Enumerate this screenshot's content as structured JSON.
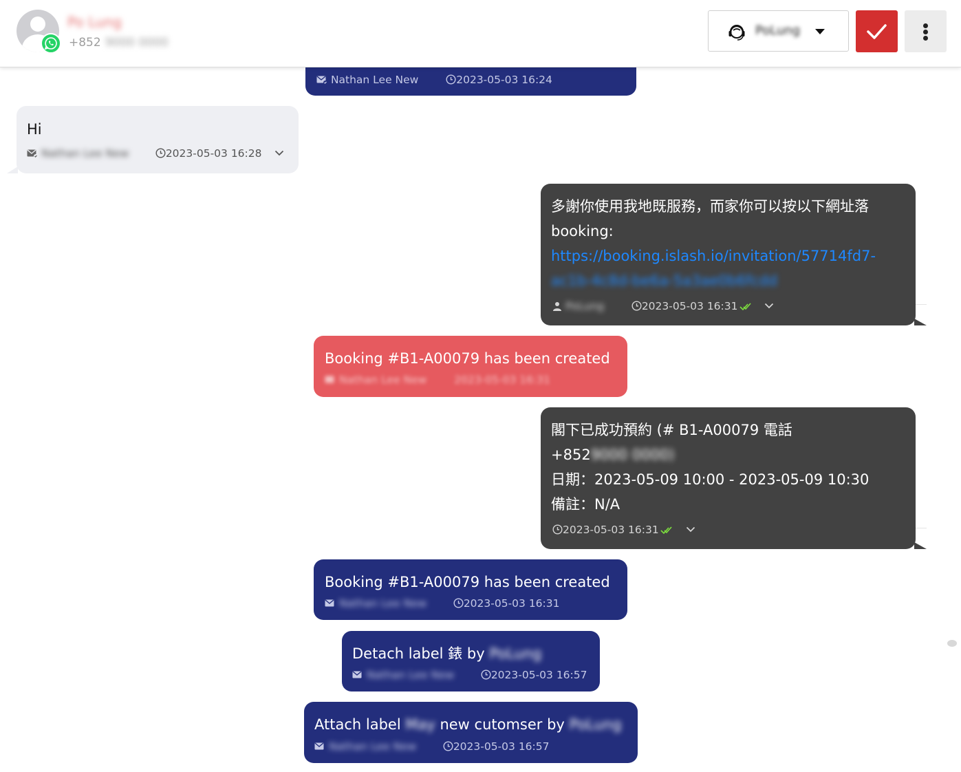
{
  "header": {
    "contact_name": "Po Lung",
    "contact_phone_prefix": "+852",
    "contact_phone_rest": "9000 0000",
    "agent_name": "PoLung",
    "colors": {
      "resolve": "#d32f2f",
      "whatsapp": "#25d366"
    }
  },
  "messages": {
    "m0": {
      "sender": "Nathan Lee New",
      "time": "2023-05-03 16:24"
    },
    "m1": {
      "text": "Hi",
      "sender": "Nathan Lee New",
      "time": "2023-05-03 16:28"
    },
    "m2": {
      "line1": "多謝你使用我地既服務，而家你可以按以下網址落",
      "line2": "booking:",
      "link1": "https://booking.islash.io/invitation/57714fd7-",
      "link2": "ac1b-4c8d-be6a-5a3ae0b6fcdd",
      "sender": "PoLung",
      "time": "2023-05-03 16:31"
    },
    "m3": {
      "text": "Booking #B1-A00079 has been created",
      "sender": "Nathan Lee New",
      "time": "2023-05-03 16:31"
    },
    "m4": {
      "line1": "閣下已成功預約 (# B1-A00079 電話",
      "line2_prefix": "+852",
      "line2_blur": "9000 0000)",
      "line3": "日期：2023-05-09 10:00 - 2023-05-09 10:30",
      "line4": "備註：N/A",
      "time": "2023-05-03 16:31"
    },
    "m5": {
      "text": "Booking #B1-A00079 has been created",
      "sender": "Nathan Lee New",
      "time": "2023-05-03 16:31"
    },
    "m6": {
      "text_prefix": "Detach label 錶 by",
      "text_blur": "PoLung",
      "sender": "Nathan Lee New",
      "time": "2023-05-03 16:57"
    },
    "m7": {
      "text_prefix": "Attach label",
      "label_blur": "May",
      "text_mid": "new cutomser by",
      "text_blur": "PoLung",
      "sender": "Nathan Lee New",
      "time": "2023-05-03 16:57"
    }
  }
}
